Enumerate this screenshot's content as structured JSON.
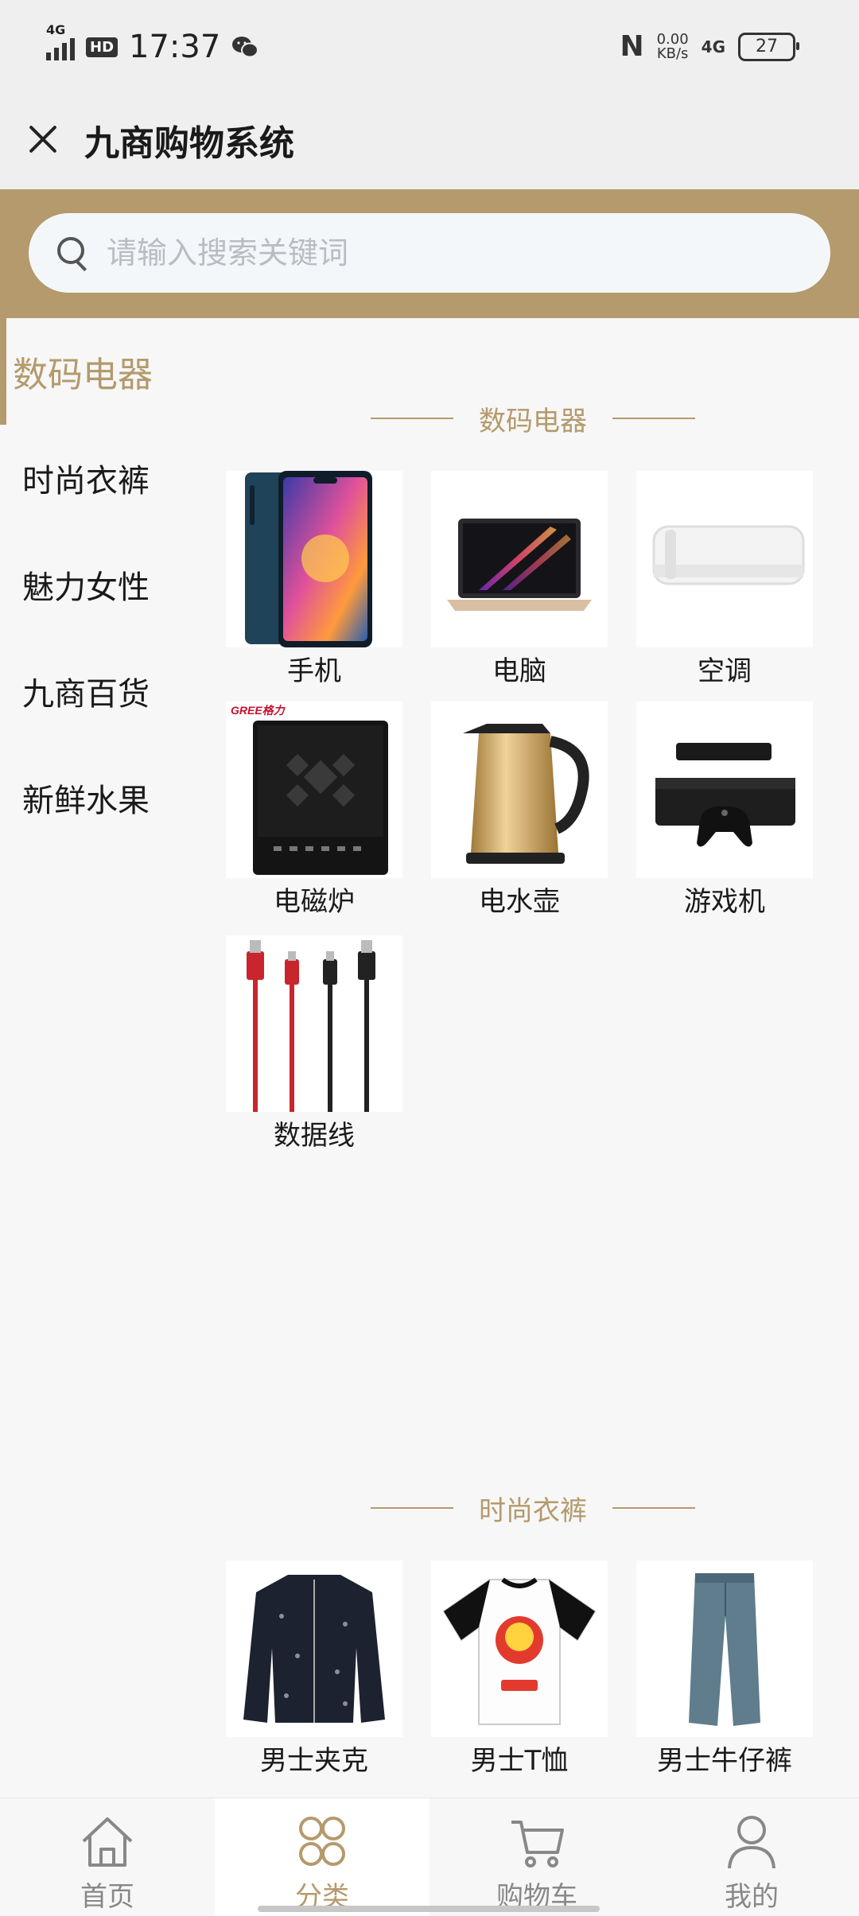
{
  "status_bar": {
    "network_left": "4G",
    "hd": "HD",
    "time": "17:37",
    "speed_value": "0.00",
    "speed_unit": "KB/s",
    "network_right": "4G",
    "battery": "27",
    "icons": [
      "signal-icon",
      "wechat-icon",
      "nfc-icon",
      "battery-icon"
    ]
  },
  "titlebar": {
    "title": "九商购物系统",
    "close_icon": "close-icon"
  },
  "search": {
    "placeholder": "请输入搜索关键词",
    "value": ""
  },
  "sidebar": {
    "items": [
      {
        "label": "数码电器",
        "active": true
      },
      {
        "label": "时尚衣裤",
        "active": false
      },
      {
        "label": "魅力女性",
        "active": false
      },
      {
        "label": "九商百货",
        "active": false
      },
      {
        "label": "新鲜水果",
        "active": false
      }
    ]
  },
  "sections": [
    {
      "title": "数码电器",
      "products": [
        {
          "name": "手机",
          "image": "smartphone"
        },
        {
          "name": "电脑",
          "image": "laptop"
        },
        {
          "name": "空调",
          "image": "air-conditioner"
        },
        {
          "name": "电磁炉",
          "image": "induction-cooker"
        },
        {
          "name": "电水壶",
          "image": "electric-kettle"
        },
        {
          "name": "游戏机",
          "image": "game-console"
        },
        {
          "name": "数据线",
          "image": "usb-cables"
        }
      ]
    },
    {
      "title": "时尚衣裤",
      "products": [
        {
          "name": "男士夹克",
          "image": "jacket"
        },
        {
          "name": "男士T恤",
          "image": "t-shirt"
        },
        {
          "name": "男士牛仔裤",
          "image": "jeans"
        }
      ]
    }
  ],
  "brand_marks": {
    "cooker": "GREE格力"
  },
  "tabbar": {
    "tabs": [
      {
        "label": "首页",
        "icon": "home-icon",
        "active": false
      },
      {
        "label": "分类",
        "icon": "category-icon",
        "active": true
      },
      {
        "label": "购物车",
        "icon": "cart-icon",
        "active": false
      },
      {
        "label": "我的",
        "icon": "user-icon",
        "active": false
      }
    ]
  },
  "colors": {
    "accent": "#b49a6c",
    "background": "#f7f7f7",
    "header": "#efefef"
  }
}
